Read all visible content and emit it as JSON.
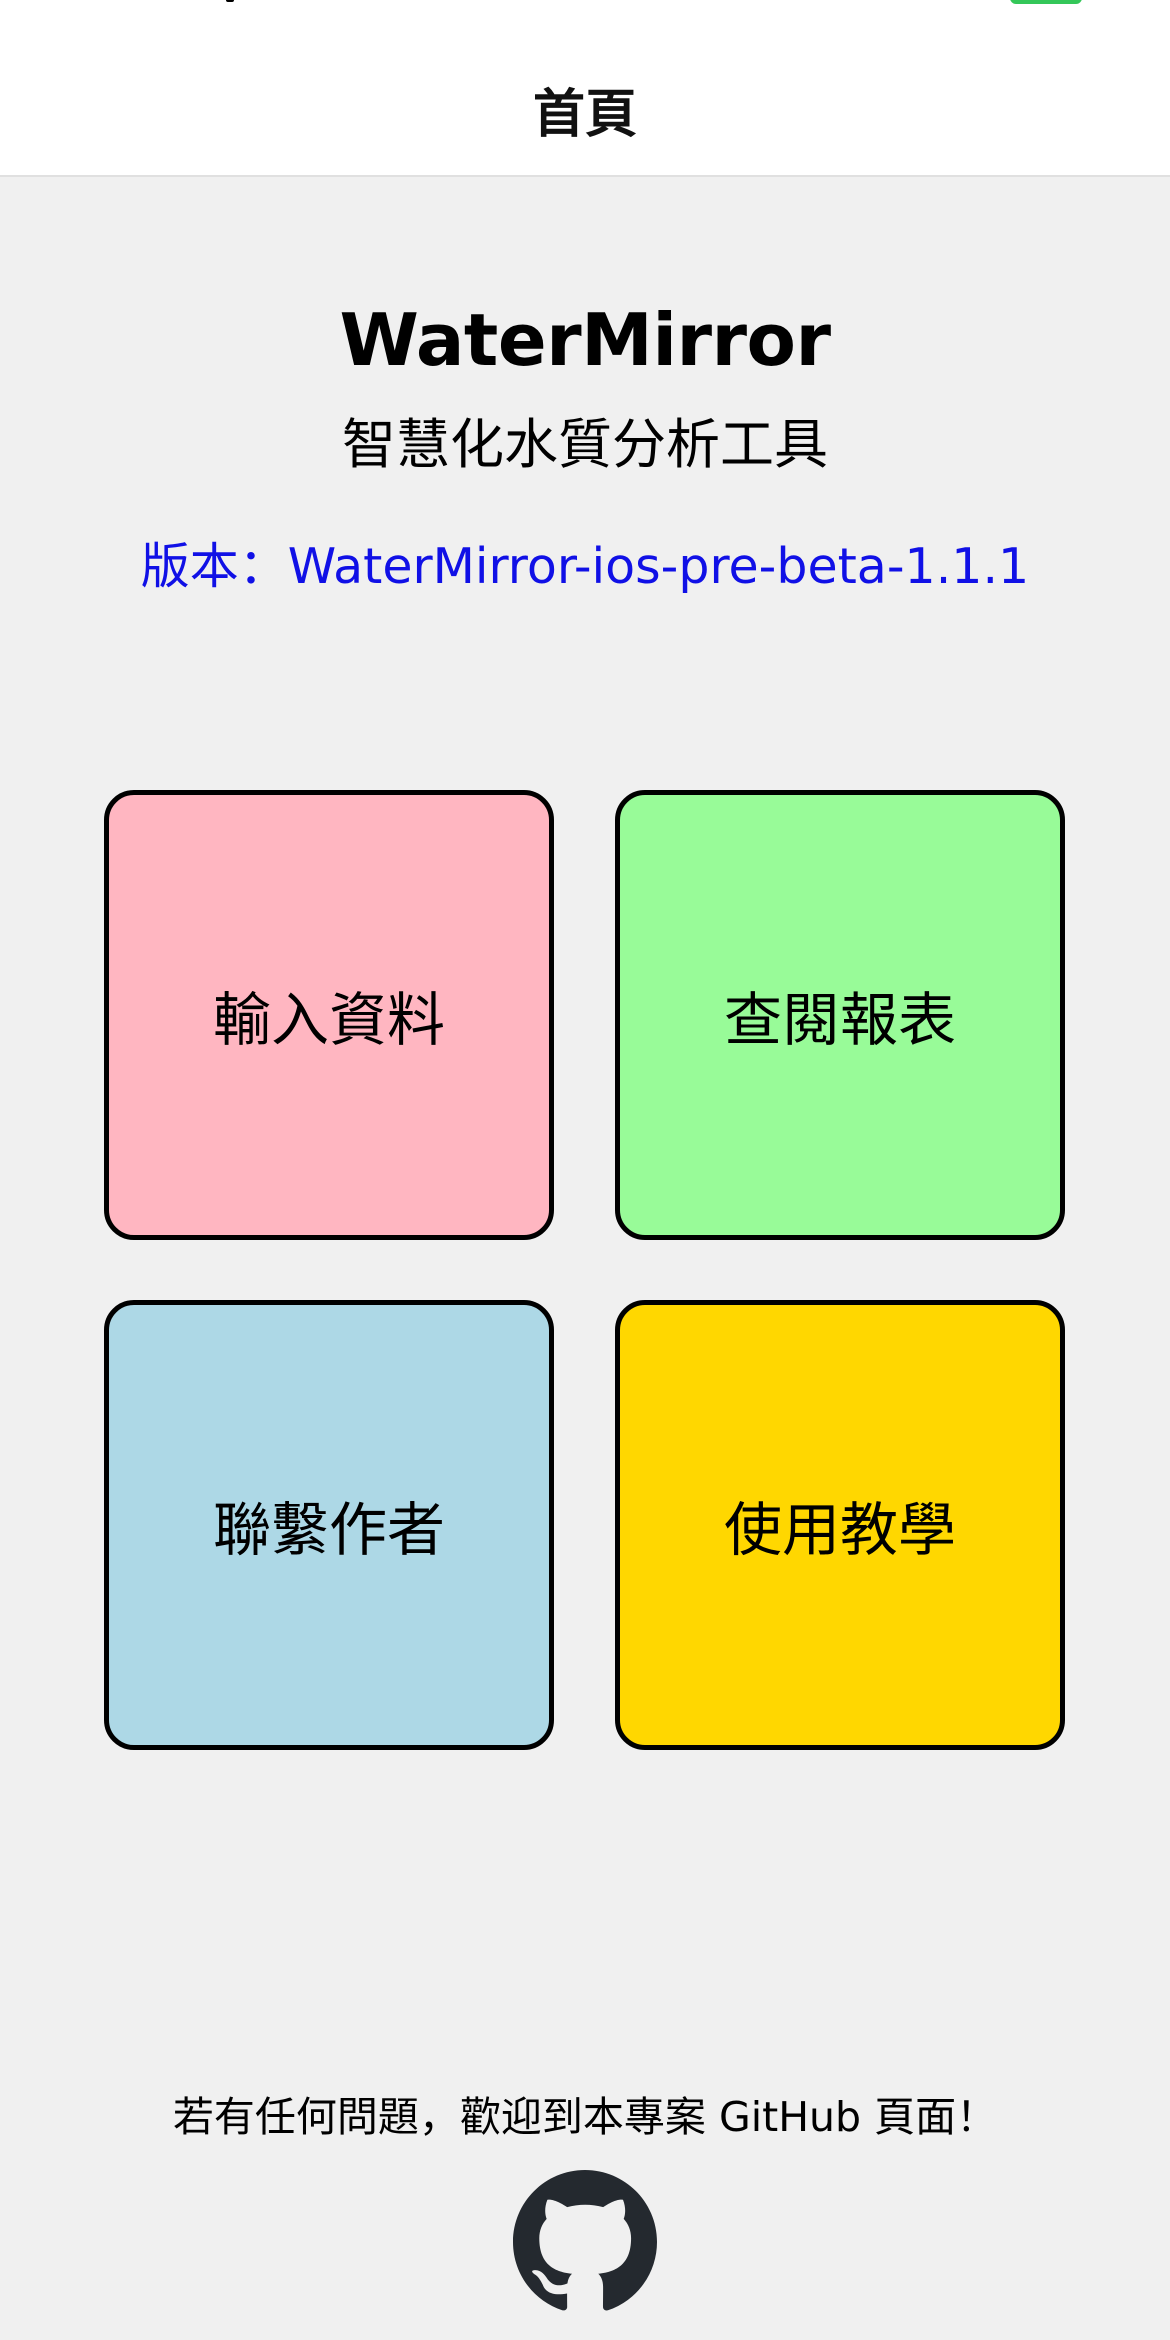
{
  "nav": {
    "title": "首頁"
  },
  "header": {
    "app_name": "WaterMirror",
    "subtitle": "智慧化水質分析工具",
    "version_text": "版本：WaterMirror-ios-pre-beta-1.1.1"
  },
  "tiles": [
    {
      "label": "輸入資料",
      "color": "#ffb6c1"
    },
    {
      "label": "查閱報表",
      "color": "#98fb98"
    },
    {
      "label": "聯繫作者",
      "color": "#add8e6"
    },
    {
      "label": "使用教學",
      "color": "#ffd700"
    }
  ],
  "footer": {
    "text": "若有任何問題，歡迎到本專案 GitHub 頁面！",
    "icon": "github-icon"
  },
  "colors": {
    "link": "#1010e6",
    "background": "#f0f0f0",
    "battery": "#34c759"
  }
}
